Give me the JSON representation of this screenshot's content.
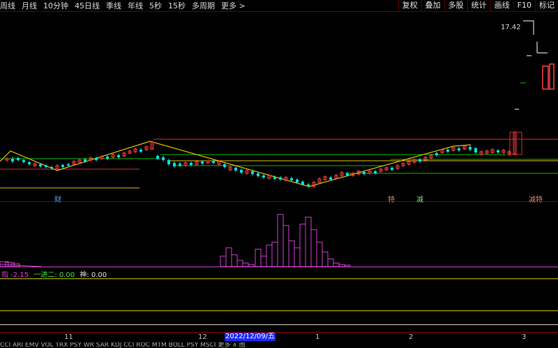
{
  "toolbar": {
    "periods": [
      "周线",
      "月线",
      "10分钟",
      "45日线",
      "季线",
      "年线",
      "5秒",
      "15秒",
      "多周期",
      "更多 >"
    ],
    "buttons": [
      "复权",
      "叠加",
      "多股",
      "统计",
      "画线",
      "F10",
      "标记"
    ]
  },
  "price_label": "17.42",
  "events": {
    "cai": "财",
    "e1": "特",
    "e2": "减",
    "e3": "减特"
  },
  "indicator": {
    "main_name": "指",
    "main_value": "-2.15",
    "l2_name": "一进二:",
    "l2_value": "0.00",
    "l3_name": "神:",
    "l3_value": "0.00"
  },
  "xaxis": {
    "m11": "11",
    "m12": "12",
    "selected_date": "2022/12/09/五",
    "m1": "1",
    "m2": "2",
    "m3": "3"
  },
  "bottom_tabs": "CCI   ARI  EMV  VOL  TRX  PSY  WR   SAR   KDJ  CCI  ROC   MTM  BOLL  PSY   MSCI   更多  ∧ 图",
  "colors": {
    "up": "#ff4040",
    "down": "#00e0e0",
    "zigzag": "#e0c000",
    "support": "#00c000",
    "resist": "#d03030",
    "hist": "#d040d0"
  },
  "candles": [
    [
      8,
      1,
      230,
      228,
      233,
      226
    ],
    [
      16,
      -1,
      228,
      232,
      234,
      225
    ],
    [
      24,
      -1,
      227,
      230,
      232,
      225
    ],
    [
      32,
      -1,
      230,
      233,
      235,
      228
    ],
    [
      40,
      -1,
      233,
      236,
      238,
      231
    ],
    [
      48,
      1,
      238,
      235,
      240,
      233
    ],
    [
      56,
      -1,
      236,
      239,
      241,
      234
    ],
    [
      64,
      -1,
      238,
      240,
      242,
      236
    ],
    [
      72,
      -1,
      240,
      242,
      244,
      238
    ],
    [
      80,
      1,
      243,
      238,
      246,
      236
    ],
    [
      88,
      -1,
      237,
      240,
      242,
      235
    ],
    [
      96,
      -1,
      236,
      238,
      240,
      234
    ],
    [
      104,
      1,
      236,
      232,
      238,
      230
    ],
    [
      112,
      1,
      233,
      230,
      235,
      228
    ],
    [
      120,
      -1,
      229,
      232,
      234,
      227
    ],
    [
      128,
      1,
      230,
      227,
      232,
      225
    ],
    [
      136,
      -1,
      227,
      230,
      232,
      225
    ],
    [
      144,
      1,
      228,
      225,
      230,
      223
    ],
    [
      152,
      -1,
      225,
      228,
      230,
      223
    ],
    [
      160,
      1,
      226,
      222,
      228,
      220
    ],
    [
      168,
      -1,
      223,
      226,
      228,
      221
    ],
    [
      176,
      1,
      224,
      220,
      226,
      218
    ],
    [
      184,
      1,
      220,
      217,
      222,
      215
    ],
    [
      192,
      1,
      218,
      214,
      220,
      212
    ],
    [
      200,
      -1,
      215,
      218,
      220,
      213
    ],
    [
      208,
      1,
      215,
      211,
      217,
      209
    ],
    [
      216,
      1,
      214,
      204,
      216,
      202
    ],
    [
      224,
      -1,
      224,
      228,
      230,
      222
    ],
    [
      232,
      -1,
      226,
      230,
      232,
      224
    ],
    [
      240,
      -1,
      230,
      236,
      238,
      228
    ],
    [
      248,
      -1,
      234,
      239,
      241,
      232
    ],
    [
      256,
      -1,
      235,
      238,
      240,
      233
    ],
    [
      264,
      1,
      238,
      234,
      240,
      232
    ],
    [
      272,
      -1,
      234,
      237,
      239,
      232
    ],
    [
      280,
      1,
      236,
      232,
      238,
      230
    ],
    [
      288,
      -1,
      232,
      235,
      237,
      230
    ],
    [
      296,
      1,
      234,
      231,
      236,
      229
    ],
    [
      304,
      -1,
      231,
      234,
      236,
      229
    ],
    [
      312,
      1,
      236,
      232,
      238,
      230
    ],
    [
      320,
      -1,
      236,
      240,
      242,
      234
    ],
    [
      328,
      1,
      244,
      240,
      246,
      238
    ],
    [
      336,
      -1,
      241,
      245,
      247,
      239
    ],
    [
      344,
      -1,
      244,
      248,
      250,
      242
    ],
    [
      352,
      1,
      249,
      245,
      251,
      243
    ],
    [
      360,
      -1,
      246,
      250,
      252,
      244
    ],
    [
      368,
      -1,
      249,
      253,
      255,
      247
    ],
    [
      376,
      -1,
      252,
      255,
      257,
      250
    ],
    [
      384,
      1,
      256,
      252,
      258,
      250
    ],
    [
      392,
      -1,
      254,
      257,
      259,
      252
    ],
    [
      400,
      -1,
      255,
      258,
      260,
      253
    ],
    [
      408,
      1,
      259,
      255,
      261,
      253
    ],
    [
      416,
      -1,
      256,
      259,
      261,
      254
    ],
    [
      424,
      -1,
      258,
      262,
      264,
      256
    ],
    [
      432,
      -1,
      261,
      265,
      267,
      259
    ],
    [
      440,
      -1,
      265,
      268,
      270,
      263
    ],
    [
      448,
      1,
      268,
      262,
      270,
      260
    ],
    [
      456,
      1,
      262,
      257,
      264,
      255
    ],
    [
      464,
      1,
      258,
      254,
      260,
      252
    ],
    [
      472,
      -1,
      255,
      258,
      260,
      253
    ],
    [
      480,
      1,
      256,
      252,
      258,
      250
    ],
    [
      488,
      1,
      252,
      248,
      254,
      246
    ],
    [
      496,
      -1,
      249,
      252,
      254,
      247
    ],
    [
      504,
      1,
      252,
      249,
      254,
      247
    ],
    [
      512,
      1,
      250,
      246,
      252,
      244
    ],
    [
      520,
      -1,
      247,
      250,
      252,
      245
    ],
    [
      528,
      1,
      249,
      246,
      251,
      244
    ],
    [
      536,
      -1,
      246,
      249,
      251,
      244
    ],
    [
      544,
      1,
      246,
      243,
      248,
      241
    ],
    [
      552,
      1,
      244,
      241,
      246,
      239
    ],
    [
      560,
      -1,
      241,
      244,
      246,
      239
    ],
    [
      568,
      1,
      242,
      238,
      244,
      236
    ],
    [
      576,
      1,
      238,
      235,
      240,
      233
    ],
    [
      584,
      1,
      236,
      232,
      238,
      230
    ],
    [
      592,
      1,
      233,
      229,
      235,
      227
    ],
    [
      600,
      -1,
      229,
      232,
      234,
      227
    ],
    [
      608,
      1,
      230,
      226,
      232,
      224
    ],
    [
      616,
      1,
      227,
      223,
      229,
      221
    ],
    [
      624,
      -1,
      220,
      223,
      225,
      218
    ],
    [
      632,
      1,
      219,
      215,
      221,
      213
    ],
    [
      640,
      -1,
      215,
      218,
      220,
      213
    ],
    [
      648,
      1,
      216,
      212,
      218,
      210
    ],
    [
      656,
      -1,
      213,
      216,
      218,
      211
    ],
    [
      664,
      1,
      214,
      210,
      216,
      208
    ],
    [
      672,
      -1,
      211,
      215,
      217,
      209
    ],
    [
      680,
      -1,
      213,
      219,
      221,
      211
    ],
    [
      688,
      1,
      222,
      218,
      224,
      216
    ],
    [
      696,
      1,
      220,
      217,
      222,
      215
    ],
    [
      704,
      1,
      219,
      215,
      221,
      213
    ],
    [
      712,
      -1,
      216,
      219,
      221,
      214
    ],
    [
      720,
      1,
      219,
      216,
      221,
      214
    ],
    [
      728,
      1,
      222,
      218,
      224,
      216
    ],
    [
      736,
      1,
      221,
      190,
      223,
      188
    ]
  ],
  "hist": [
    [
      0,
      376,
      12
    ],
    [
      8,
      377,
      12
    ],
    [
      16,
      379,
      12
    ],
    [
      316,
      368,
      8
    ],
    [
      324,
      356,
      8
    ],
    [
      332,
      366,
      8
    ],
    [
      340,
      374,
      8
    ],
    [
      348,
      378,
      8
    ],
    [
      356,
      380,
      8
    ],
    [
      366,
      358,
      8
    ],
    [
      374,
      368,
      8
    ],
    [
      382,
      352,
      8
    ],
    [
      390,
      348,
      8
    ],
    [
      398,
      308,
      8
    ],
    [
      406,
      324,
      8
    ],
    [
      414,
      346,
      8
    ],
    [
      422,
      356,
      8
    ],
    [
      430,
      322,
      8
    ],
    [
      438,
      312,
      8
    ],
    [
      446,
      330,
      8
    ],
    [
      454,
      348,
      8
    ],
    [
      462,
      362,
      8
    ],
    [
      470,
      372,
      8
    ],
    [
      478,
      378,
      8
    ],
    [
      486,
      380,
      8
    ],
    [
      494,
      381,
      8
    ]
  ]
}
